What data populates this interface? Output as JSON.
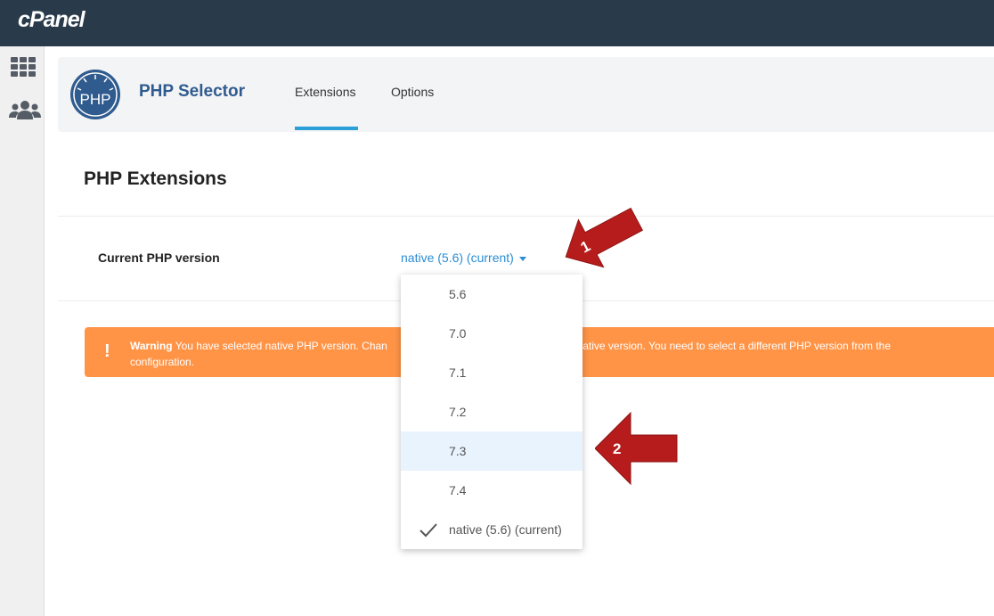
{
  "brand": {
    "logo_text": "cPanel"
  },
  "sidebar": {
    "items": [
      {
        "icon": "grid-icon"
      },
      {
        "icon": "users-icon"
      }
    ]
  },
  "header": {
    "logo_text": "PHP",
    "title": "PHP Selector",
    "tabs": [
      {
        "label": "Extensions",
        "active": true
      },
      {
        "label": "Options",
        "active": false
      }
    ]
  },
  "main": {
    "section_title": "PHP Extensions",
    "version_label": "Current PHP version",
    "version_value": "native (5.6) (current)"
  },
  "warning": {
    "prefix": "Warning",
    "text_visible_left": "You have selected native PHP version. Chan",
    "text_visible_right": "possible for the native version. You need to select a different PHP version from the",
    "text_line2": "configuration."
  },
  "dropdown": {
    "options": [
      {
        "label": "5.6",
        "highlighted": false,
        "checked": false
      },
      {
        "label": "7.0",
        "highlighted": false,
        "checked": false
      },
      {
        "label": "7.1",
        "highlighted": false,
        "checked": false
      },
      {
        "label": "7.2",
        "highlighted": false,
        "checked": false
      },
      {
        "label": "7.3",
        "highlighted": true,
        "checked": false
      },
      {
        "label": "7.4",
        "highlighted": false,
        "checked": false
      },
      {
        "label": "native (5.6) (current)",
        "highlighted": false,
        "checked": true
      }
    ]
  },
  "annotations": [
    {
      "number": "1"
    },
    {
      "number": "2"
    }
  ],
  "colors": {
    "topbar": "#293a4a",
    "accent": "#2a9fd8",
    "warning": "#ff9447",
    "annotation_arrow": "#b71c1c"
  }
}
